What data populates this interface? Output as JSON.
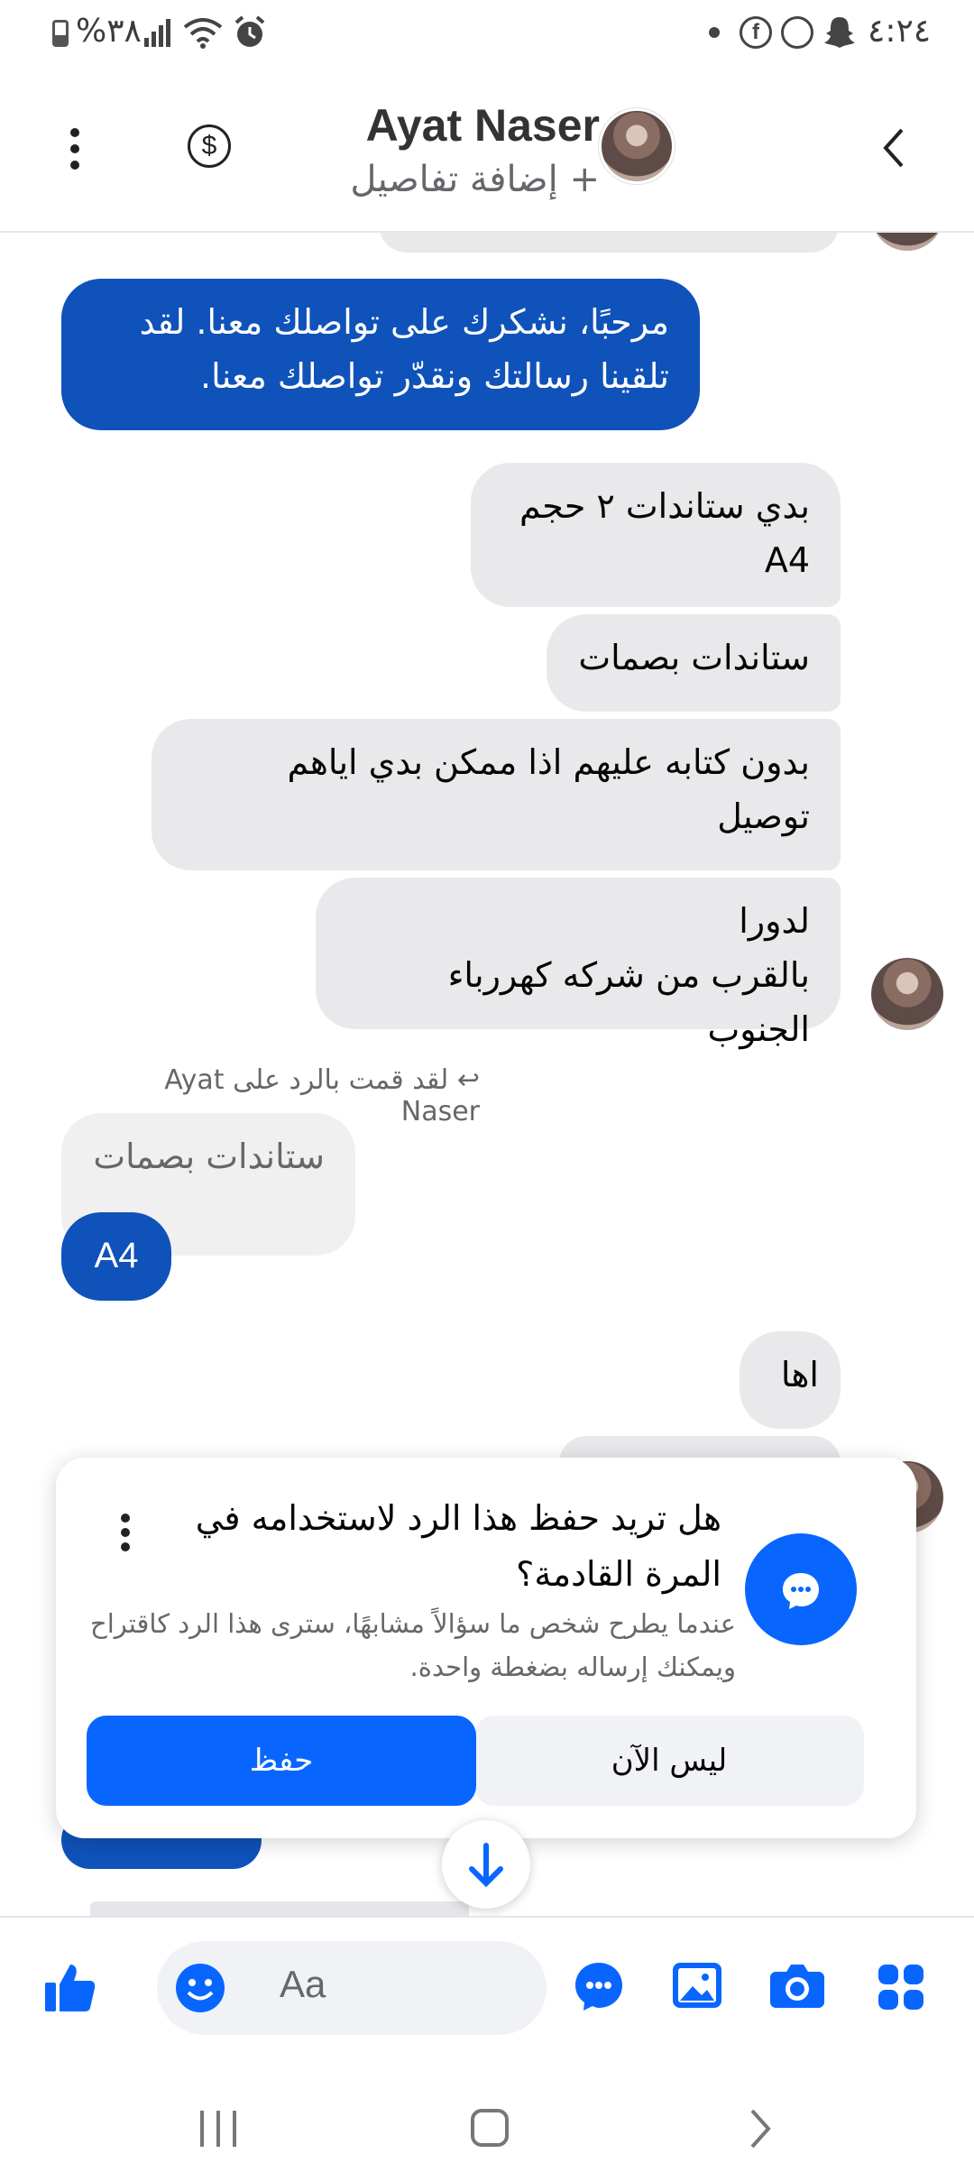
{
  "status_bar": {
    "time": "٤:٢٤",
    "battery": "%٣٨"
  },
  "header": {
    "contact_name": "Ayat Naser",
    "add_details": "+ إضافة تفاصيل"
  },
  "messages": [
    {
      "text_lines": [
        "مرحبًا، نشكرك على تواصلك معنا. لقد",
        "تلقينا رسالتك ونقدّر تواصلك معنا."
      ]
    },
    {
      "text_lines": [
        "بدي ستاندات ٢ حجم",
        "A4"
      ]
    },
    {
      "text_lines": [
        "ستاندات بصمات"
      ]
    },
    {
      "text_lines": [
        "بدون كتابه عليهم اذا ممكن بدي اياهم",
        "توصيل"
      ]
    },
    {
      "text_lines": [
        "لدورا",
        "بالقرب من شركه كهررباء الجنوب"
      ]
    },
    {
      "text_lines": [
        "اها"
      ]
    }
  ],
  "reply": {
    "meta": "لقد قمت بالرد على Ayat Naser",
    "quoted": "ستاندات بصمات",
    "reply_text": "A4"
  },
  "save_popup": {
    "title": "هل تريد حفظ هذا الرد لاستخدامه في المرة القادمة؟",
    "description": "عندما يطرح شخص ما سؤالاً مشابهًا، سترى هذا الرد كاقتراح ويمكنك إرساله بضغطة واحدة.",
    "save_label": "حفظ",
    "not_now_label": "ليس الآن"
  },
  "composer": {
    "placeholder": "Aa"
  },
  "colors": {
    "accent": "#0866ff",
    "outgoing_bubble": "#0f52ba",
    "incoming_bubble": "#e9e9eb"
  }
}
